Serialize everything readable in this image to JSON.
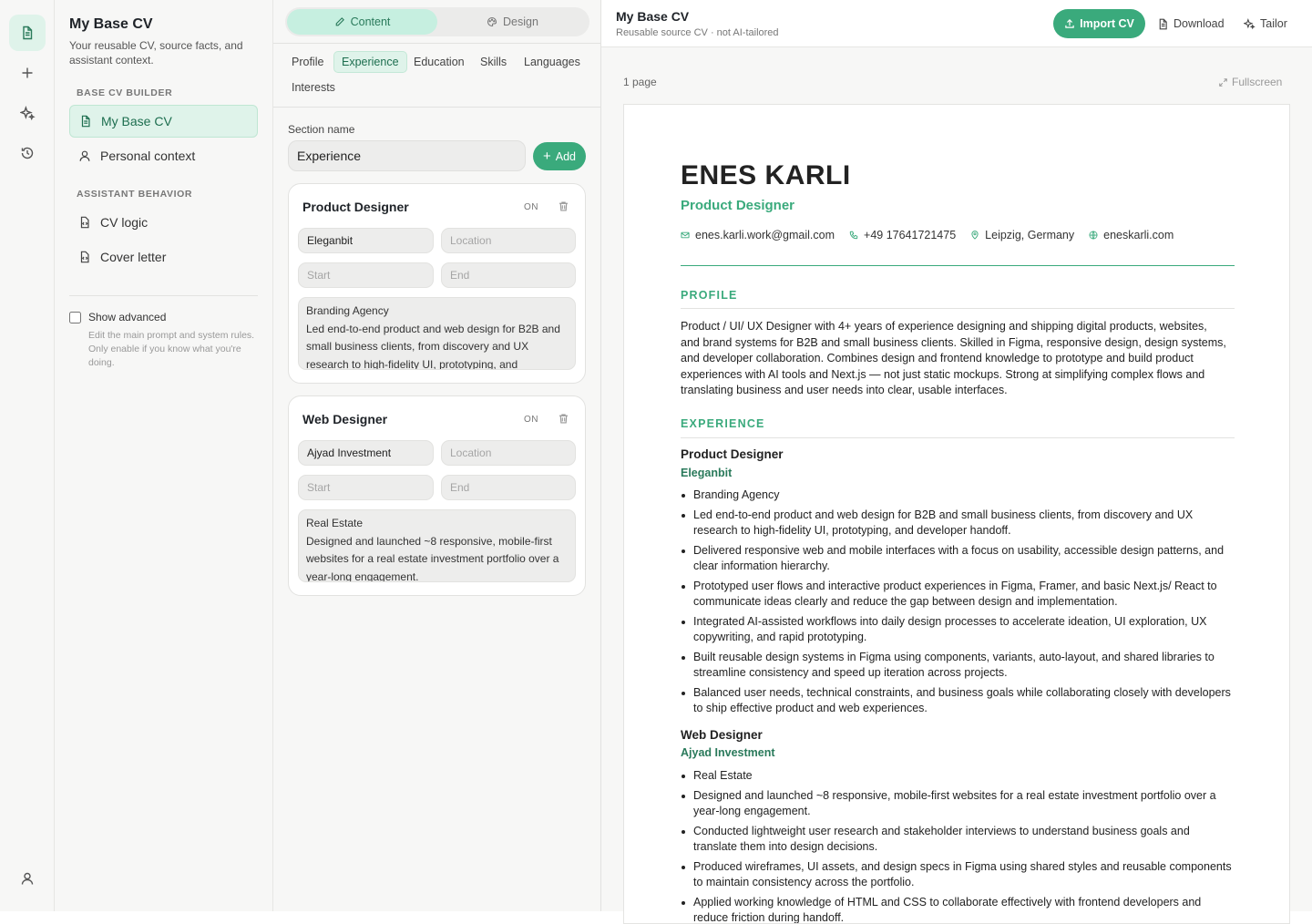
{
  "sidebar": {
    "title": "My Base CV",
    "subtitle": "Your reusable CV, source facts, and assistant context.",
    "section_builder": "BASE CV BUILDER",
    "items_builder": [
      {
        "label": "My Base CV"
      },
      {
        "label": "Personal context"
      }
    ],
    "section_behavior": "ASSISTANT BEHAVIOR",
    "items_behavior": [
      {
        "label": "CV logic"
      },
      {
        "label": "Cover letter"
      }
    ],
    "advanced_label": "Show advanced",
    "advanced_note": "Edit the main prompt and system rules. Only enable if you know what you're doing.",
    "accent": "#3aaa7c"
  },
  "editor": {
    "mode_tabs": [
      {
        "label": "Content"
      },
      {
        "label": "Design"
      }
    ],
    "section_tabs": [
      {
        "label": "Profile"
      },
      {
        "label": "Experience"
      },
      {
        "label": "Education"
      },
      {
        "label": "Skills"
      },
      {
        "label": "Languages"
      },
      {
        "label": "Interests"
      }
    ],
    "section_name_label": "Section name",
    "section_name_value": "Experience",
    "add_label": "Add",
    "entries": [
      {
        "title": "Product Designer",
        "toggle": "ON",
        "company": "Eleganbit",
        "location_placeholder": "Location",
        "start_placeholder": "Start",
        "end_placeholder": "End",
        "description": "Branding Agency\nLed end-to-end product and web design for B2B and small business clients, from discovery and UX research to high-fidelity UI, prototyping, and"
      },
      {
        "title": "Web Designer",
        "toggle": "ON",
        "company": "Ajyad Investment",
        "location_placeholder": "Location",
        "start_placeholder": "Start",
        "end_placeholder": "End",
        "description": "Real Estate\nDesigned and launched ~8 responsive, mobile-first websites for a real estate investment portfolio over a year-long engagement."
      }
    ]
  },
  "header": {
    "title": "My Base CV",
    "subtitle": "Reusable source CV · not AI-tailored",
    "import_label": "Import CV",
    "download_label": "Download",
    "tailor_label": "Tailor"
  },
  "preview": {
    "pages": "1 page",
    "fullscreen": "Fullscreen"
  },
  "cv": {
    "name": "ENES KARLI",
    "role": "Product Designer",
    "email": "enes.karli.work@gmail.com",
    "phone": "+49 17641721475",
    "location": "Leipzig, Germany",
    "website": "eneskarli.com",
    "profile_heading": "PROFILE",
    "profile_text": "Product / UI/ UX Designer with 4+ years of experience designing and shipping digital products, websites, and brand systems for B2B and small business clients. Skilled in Figma, responsive design, design systems, and developer collaboration. Combines design and frontend knowledge to prototype and build product experiences with AI tools and Next.js — not just static mockups. Strong at simplifying complex flows and translating business and user needs into clear, usable interfaces.",
    "experience_heading": "EXPERIENCE",
    "jobs": [
      {
        "title": "Product Designer",
        "company": "Eleganbit",
        "bullets": [
          "Branding Agency",
          "Led end-to-end product and web design for B2B and small business clients, from discovery and UX research to high-fidelity UI, prototyping, and developer handoff.",
          "Delivered responsive web and mobile interfaces with a focus on usability, accessible design patterns, and clear information hierarchy.",
          "Prototyped user flows and interactive product experiences in Figma, Framer, and basic Next.js/ React to communicate ideas clearly and reduce the gap between design and implementation.",
          "Integrated AI-assisted workflows into daily design processes to accelerate ideation, UI exploration, UX copywriting, and rapid prototyping.",
          "Built reusable design systems in Figma using components, variants, auto-layout, and shared libraries to streamline consistency and speed up iteration across projects.",
          "Balanced user needs, technical constraints, and business goals while collaborating closely with developers to ship effective product and web experiences."
        ]
      },
      {
        "title": "Web Designer",
        "company": "Ajyad Investment",
        "bullets": [
          "Real Estate",
          "Designed and launched ~8 responsive, mobile-first websites for a real estate investment portfolio over a year-long engagement.",
          "Conducted lightweight user research and stakeholder interviews to understand business goals and translate them into design decisions.",
          "Produced wireframes, UI assets, and design specs in Figma using shared styles and reusable components to maintain consistency across the portfolio.",
          "Applied working knowledge of HTML and CSS to collaborate effectively with frontend developers and reduce friction during handoff."
        ]
      }
    ]
  }
}
